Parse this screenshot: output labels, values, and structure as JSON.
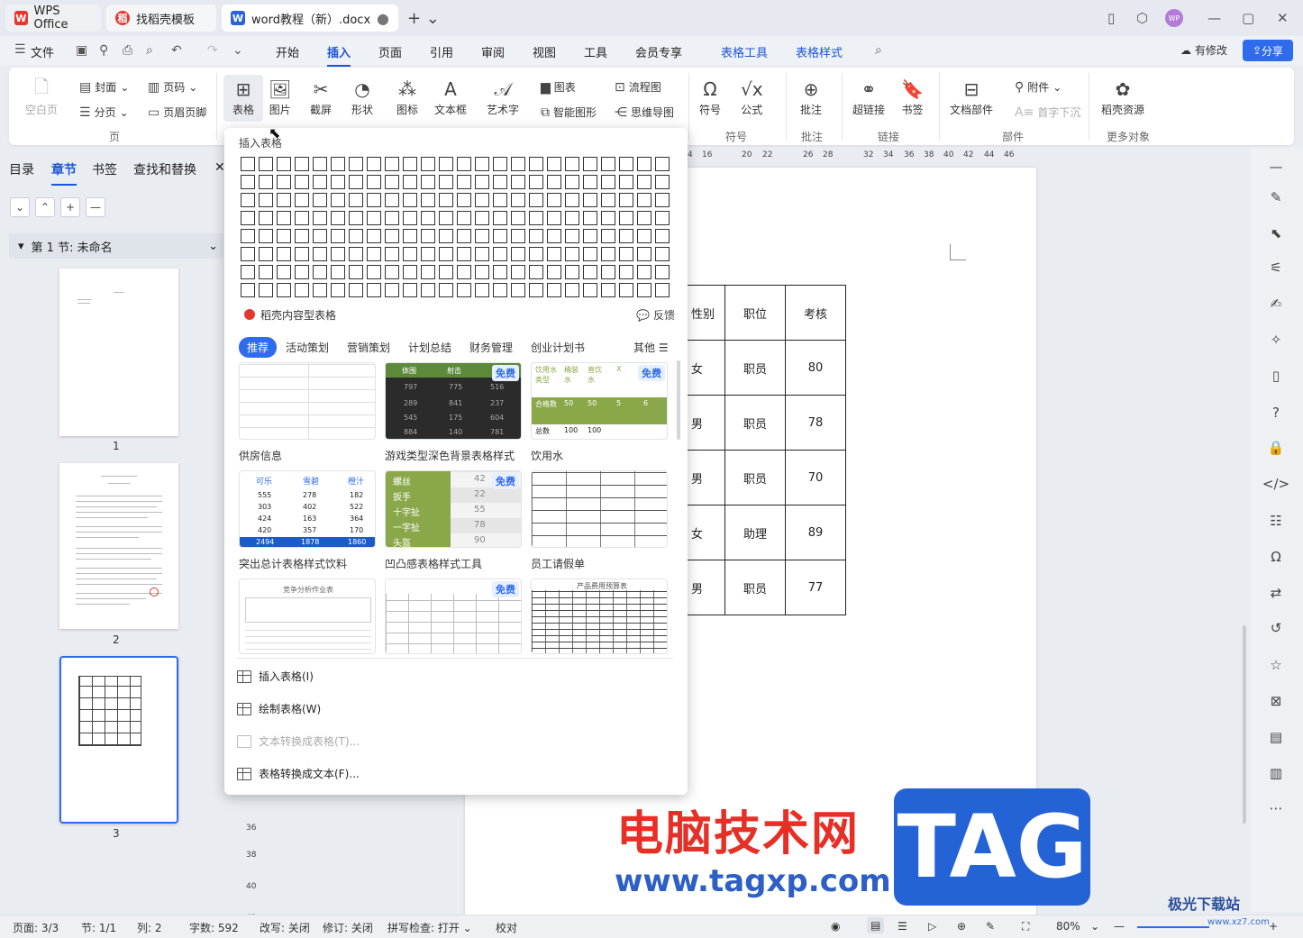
{
  "titlebar": {
    "tabs": [
      {
        "label": "WPS Office",
        "logo": "W"
      },
      {
        "label": "找稻壳模板",
        "logo": "稻"
      },
      {
        "label": "word教程（新）.docx",
        "logo": "W"
      }
    ],
    "add_icon": "+ ⌄",
    "avatar": "WP",
    "unsaved_dot": "●"
  },
  "menubar": {
    "file": "文件",
    "items": [
      "开始",
      "插入",
      "页面",
      "引用",
      "审阅",
      "视图",
      "工具",
      "会员专享"
    ],
    "context": [
      "表格工具",
      "表格样式"
    ],
    "modified": "有修改",
    "share": "分享"
  },
  "ribbon": {
    "blank_page": "空白页",
    "cover": "封面",
    "page_break": "分页",
    "page_number": "页码",
    "header_footer": "页眉页脚",
    "group_page": "页",
    "table": "表格",
    "picture": "图片",
    "screenshot": "截屏",
    "shape": "形状",
    "icon": "图标",
    "textbox": "文本框",
    "wordart": "艺术字",
    "chart": "图表",
    "smartart": "智能图形",
    "flowchart": "流程图",
    "mindmap": "思维导图",
    "symbol": "符号",
    "formula": "公式",
    "group_symbol": "符号",
    "comment": "批注",
    "group_comment": "批注",
    "hyperlink": "超链接",
    "bookmark": "书签",
    "group_link": "链接",
    "doc_parts": "文档部件",
    "attachment": "附件",
    "drop_cap": "首字下沉",
    "group_parts": "部件",
    "docer": "稻壳资源",
    "group_more": "更多对象"
  },
  "leftpanel": {
    "tabs": [
      "目录",
      "章节",
      "书签",
      "查找和替换"
    ],
    "close": "✕",
    "section": "第 1 节: 未命名",
    "pages": [
      "1",
      "2",
      "3"
    ]
  },
  "ruler": {
    "h": [
      "4",
      "16",
      "20",
      "22",
      "26",
      "28",
      "32",
      "34",
      "36",
      "38",
      "40",
      "42",
      "44",
      "46"
    ],
    "v": [
      "36",
      "38",
      "40",
      "42"
    ]
  },
  "doc_table": {
    "header": [
      "性别",
      "职位",
      "考核"
    ],
    "rows": [
      [
        "女",
        "职员",
        "80"
      ],
      [
        "男",
        "职员",
        "78"
      ],
      [
        "男",
        "职员",
        "70"
      ],
      [
        "女",
        "助理",
        "89"
      ],
      [
        "男",
        "职员",
        "77"
      ]
    ]
  },
  "dropdown": {
    "title": "插入表格",
    "docer_tables": "稻壳内容型表格",
    "feedback": "反馈",
    "categories": [
      "推荐",
      "活动策划",
      "营销策划",
      "计划总结",
      "财务管理",
      "创业计划书",
      "其他 ☰"
    ],
    "free": "免费",
    "templates": [
      "供房信息",
      "游戏类型深色背景表格样式",
      "饮用水",
      "突出总计表格样式饮料",
      "凹凸感表格样式工具",
      "员工请假单"
    ],
    "tpl_cells": {
      "game": [
        "体围",
        "射击",
        "797",
        "775",
        "516",
        "289",
        "841",
        "237",
        "545",
        "175",
        "604",
        "884",
        "140",
        "781"
      ],
      "water": [
        "饮用水类型",
        "桶装水",
        "直饮水",
        "X",
        "合格数",
        "50",
        "50",
        "5",
        "6",
        "总数",
        "100",
        "100"
      ],
      "drink": [
        "可乐",
        "雪碧",
        "橙汁",
        "555",
        "278",
        "182",
        "303",
        "402",
        "522",
        "424",
        "163",
        "364",
        "420",
        "357",
        "170",
        "2494",
        "1878",
        "1860"
      ],
      "tool": [
        "螺丝",
        "42",
        "扳手",
        "22",
        "十字扯",
        "55",
        "一字扯",
        "78",
        "头盔",
        "90"
      ],
      "analysis": "竞争分析作业表",
      "budget": "产品费用预算表"
    },
    "actions": [
      "插入表格(I)",
      "绘制表格(W)",
      "文本转换成表格(T)...",
      "表格转换成文本(F)..."
    ]
  },
  "statusbar": {
    "page": "页面: 3/3",
    "section": "节: 1/1",
    "column": "列: 2",
    "words": "字数: 592",
    "overtype": "改写: 关闭",
    "revision": "修订: 关闭",
    "spell": "拼写检查: 打开 ⌄",
    "proof": "校对",
    "zoom": "80%"
  },
  "watermark": {
    "cn": "电脑技术网",
    "url": "www.tagxp.com",
    "tag": "TAG",
    "jg": "极光下载站",
    "jg_sub": "www.xz7.com"
  },
  "colors": {
    "accent": "#2f6bed",
    "wps_red": "#e6372f",
    "dark_tpl": "#2b2b2b",
    "green_tpl": "#8aa84a"
  }
}
